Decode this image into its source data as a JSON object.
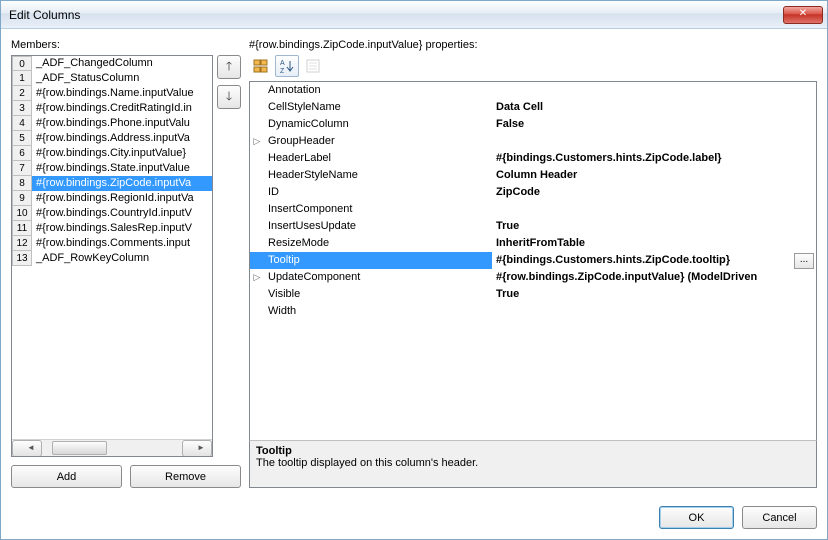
{
  "window": {
    "title": "Edit Columns"
  },
  "labels": {
    "members": "Members:",
    "properties_prefix": "#{row.bindings.ZipCode.inputValue} properties:"
  },
  "members": [
    {
      "idx": 0,
      "text": "_ADF_ChangedColumn"
    },
    {
      "idx": 1,
      "text": "_ADF_StatusColumn"
    },
    {
      "idx": 2,
      "text": "#{row.bindings.Name.inputValue"
    },
    {
      "idx": 3,
      "text": "#{row.bindings.CreditRatingId.in"
    },
    {
      "idx": 4,
      "text": "#{row.bindings.Phone.inputValu"
    },
    {
      "idx": 5,
      "text": "#{row.bindings.Address.inputVa"
    },
    {
      "idx": 6,
      "text": "#{row.bindings.City.inputValue}"
    },
    {
      "idx": 7,
      "text": "#{row.bindings.State.inputValue"
    },
    {
      "idx": 8,
      "text": "#{row.bindings.ZipCode.inputVa",
      "selected": true
    },
    {
      "idx": 9,
      "text": "#{row.bindings.RegionId.inputVa"
    },
    {
      "idx": 10,
      "text": "#{row.bindings.CountryId.inputV"
    },
    {
      "idx": 11,
      "text": "#{row.bindings.SalesRep.inputV"
    },
    {
      "idx": 12,
      "text": "#{row.bindings.Comments.input"
    },
    {
      "idx": 13,
      "text": "_ADF_RowKeyColumn"
    }
  ],
  "properties": [
    {
      "name": "Annotation",
      "value": ""
    },
    {
      "name": "CellStyleName",
      "value": "Data Cell"
    },
    {
      "name": "DynamicColumn",
      "value": "False"
    },
    {
      "name": "GroupHeader",
      "value": "",
      "expandable": true
    },
    {
      "name": "HeaderLabel",
      "value": "#{bindings.Customers.hints.ZipCode.label}"
    },
    {
      "name": "HeaderStyleName",
      "value": "Column Header"
    },
    {
      "name": "ID",
      "value": "ZipCode"
    },
    {
      "name": "InsertComponent",
      "value": ""
    },
    {
      "name": "InsertUsesUpdate",
      "value": "True"
    },
    {
      "name": "ResizeMode",
      "value": "InheritFromTable"
    },
    {
      "name": "Tooltip",
      "value": "#{bindings.Customers.hints.ZipCode.tooltip}",
      "selected": true
    },
    {
      "name": "UpdateComponent",
      "value": "#{row.bindings.ZipCode.inputValue} (ModelDriven",
      "expandable": true
    },
    {
      "name": "Visible",
      "value": "True"
    },
    {
      "name": "Width",
      "value": ""
    }
  ],
  "description": {
    "title": "Tooltip",
    "text": "The tooltip displayed on this column's header."
  },
  "buttons": {
    "add": "Add",
    "remove": "Remove",
    "ok": "OK",
    "cancel": "Cancel"
  }
}
